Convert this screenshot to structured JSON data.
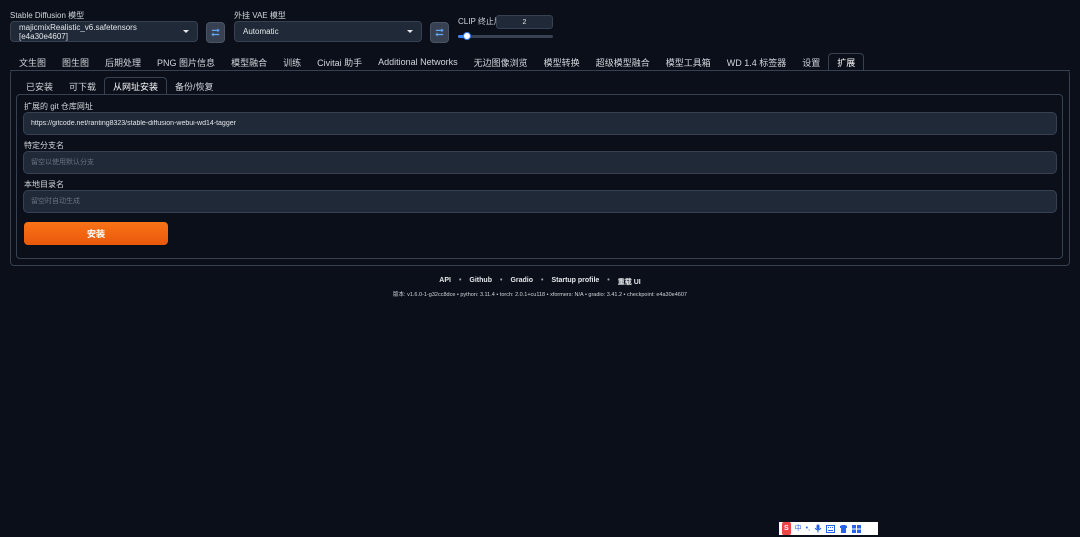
{
  "header": {
    "sd_model_label": "Stable Diffusion 模型",
    "sd_model_value": "majicmixRealistic_v6.safetensors [e4a30e4607]",
    "vae_label": "外挂 VAE 模型",
    "vae_value": "Automatic",
    "clip_label": "CLIP 终止层数",
    "clip_value": "2",
    "clip_fraction": 0.09
  },
  "main_tabs": [
    "文生图",
    "图生图",
    "后期处理",
    "PNG 图片信息",
    "模型融合",
    "训练",
    "Civitai 助手",
    "Additional Networks",
    "无边图像浏览",
    "模型转换",
    "超级模型融合",
    "模型工具箱",
    "WD 1.4 标签器",
    "设置",
    "扩展"
  ],
  "sub_tabs": [
    "已安装",
    "可下载",
    "从网址安装",
    "备份/恢复"
  ],
  "form": {
    "git_label": "扩展的 git 仓库网址",
    "git_value": "https://gitcode.net/ranting8323/stable-diffusion-webui-wd14-tagger",
    "branch_label": "特定分支名",
    "branch_placeholder": "留空以使用默认分支",
    "dir_label": "本地目录名",
    "dir_placeholder": "留空时自动生成",
    "install_label": "安装"
  },
  "footer": {
    "links": [
      "API",
      "Github",
      "Gradio",
      "Startup profile",
      "重载 UI"
    ],
    "versions": "版本: v1.6.0-1-g32cc8dce  •  python: 3.11.4  •  torch: 2.0.1+cu118  •  xformers: N/A  •  gradio: 3.41.2  •  checkpoint: e4a30e4607"
  },
  "ime": {
    "logo": "S",
    "mode": "中",
    "punct": "•,"
  }
}
